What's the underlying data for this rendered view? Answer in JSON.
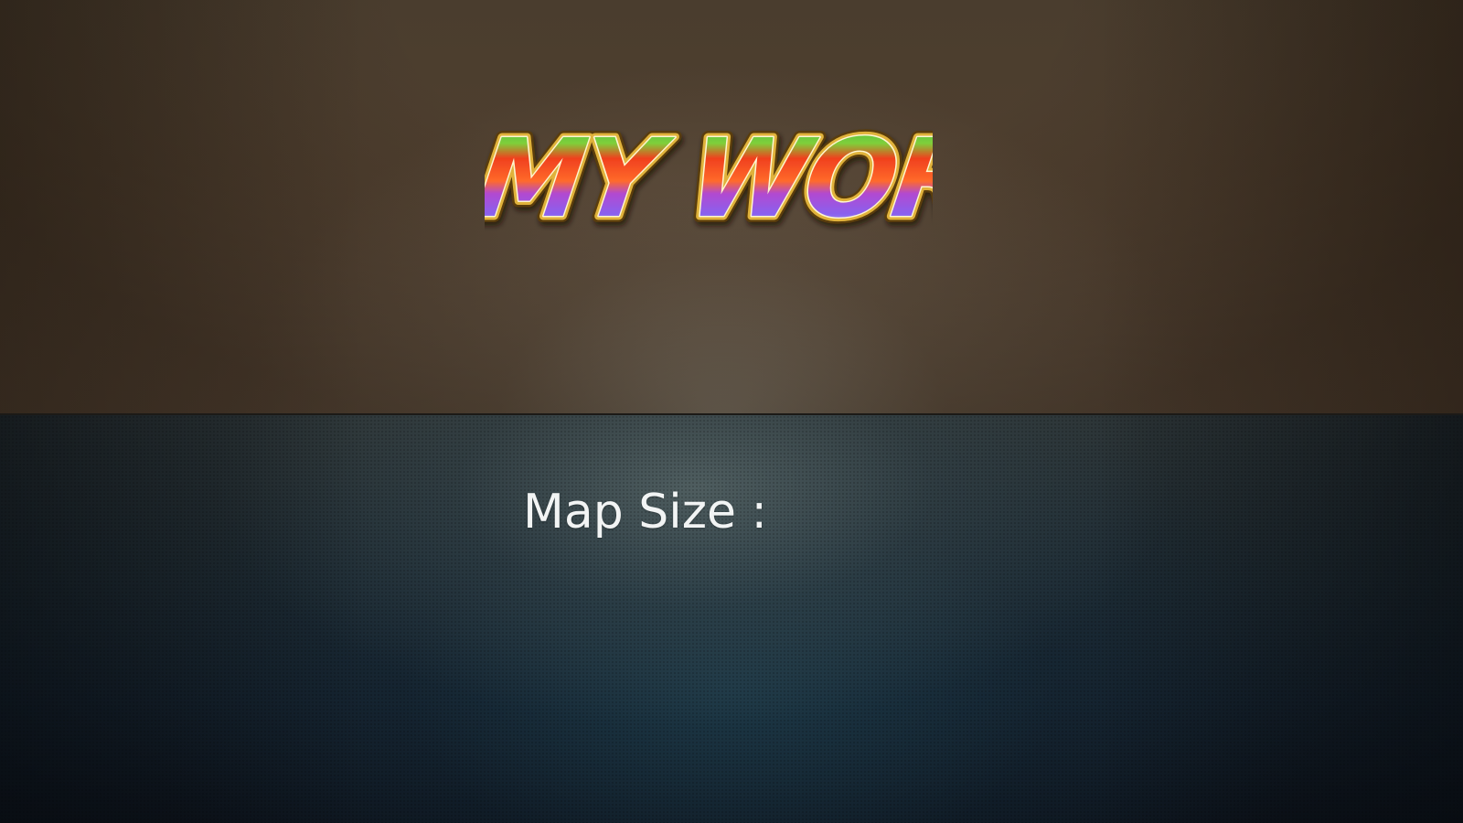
{
  "screen": {
    "name": "main-menu"
  },
  "logo": {
    "text": "MY WORLD",
    "word1": "MY",
    "word2": "WORLD",
    "colors": {
      "outline": "#c99a2a",
      "outline_dark": "#5a3d0a",
      "green": "#3cc43a",
      "red": "#f0401e",
      "orange": "#ff7a2a",
      "purple": "#8a55e6",
      "blue": "#a8c8ff"
    }
  },
  "map_settings": {
    "label": "Map Size :"
  },
  "colors": {
    "top_panel": "#4f3f2f",
    "bottom_panel": "#1c2a33",
    "label_text": "#f2f4f4"
  }
}
